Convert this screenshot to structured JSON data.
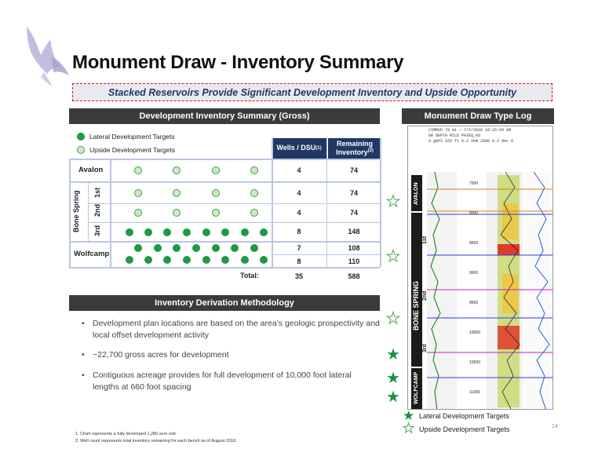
{
  "title": "Monument Draw - Inventory Summary",
  "banner": "Stacked Reservoirs Provide Significant Development Inventory and Upside Opportunity",
  "left_header": "Development Inventory Summary (Gross)",
  "right_header": "Monument Draw Type Log",
  "legend": {
    "lateral": "Lateral Development Targets",
    "upside": "Upside Development Targets"
  },
  "table": {
    "col1": "Wells / DSU",
    "col1_sup": "(1)",
    "col2": "Remaining Inventory",
    "col2_sup": "(2)",
    "group_label": "Bone Spring",
    "rows": [
      {
        "name": "Avalon",
        "wells": "4",
        "remaining": "74"
      },
      {
        "name": "1st",
        "wells": "4",
        "remaining": "74"
      },
      {
        "name": "2nd",
        "wells": "4",
        "remaining": "74"
      },
      {
        "name": "3rd",
        "wells": "8",
        "remaining": "148"
      },
      {
        "name": "Wolfcamp",
        "wells": "7",
        "remaining": "108"
      },
      {
        "name": "",
        "wells": "8",
        "remaining": "110"
      }
    ],
    "total_label": "Total:",
    "total_wells": "35",
    "total_remaining": "588"
  },
  "method_header": "Inventory Derivation Methodology",
  "bullets": [
    "Development plan locations are based on the area’s geologic prospectivity and local offset development activity",
    "~22,700 gross acres for development",
    "Contiguous acreage provides for full development of 10,000 foot lateral lengths at 660 foot spacing"
  ],
  "log": {
    "header_lines": [
      "CIMMVD 79 81 — 7/2/2018 10:15:29 AM",
      "GR   DEPTH   RILD   PHIEQ_KO",
      "0 gAPI 165   ft   0.2 ohm 2000  0.2 dec 0"
    ],
    "depths": [
      "7500",
      "8000",
      "8500",
      "9000",
      "9500",
      "10000",
      "10500",
      "11000"
    ],
    "zones": [
      "AVALON",
      "1st",
      "BONE SPRING",
      "2nd",
      "3rd",
      "WOLFCAMP"
    ]
  },
  "log_legend": {
    "lateral": "Lateral Development Targets",
    "upside": "Upside Development Targets"
  },
  "footnotes": [
    "1.       Chart represents a fully developed 1,280 acre unit",
    "2.       Well count represents total inventory remaining for each bench as of August 2018."
  ],
  "page_number": "14",
  "colors": {
    "dark_green": "#1d9a45",
    "light_green": "#cfe8c4",
    "navy": "#1f3864",
    "dark_header": "#3b3b3b",
    "banner_border": "#dd1111"
  }
}
